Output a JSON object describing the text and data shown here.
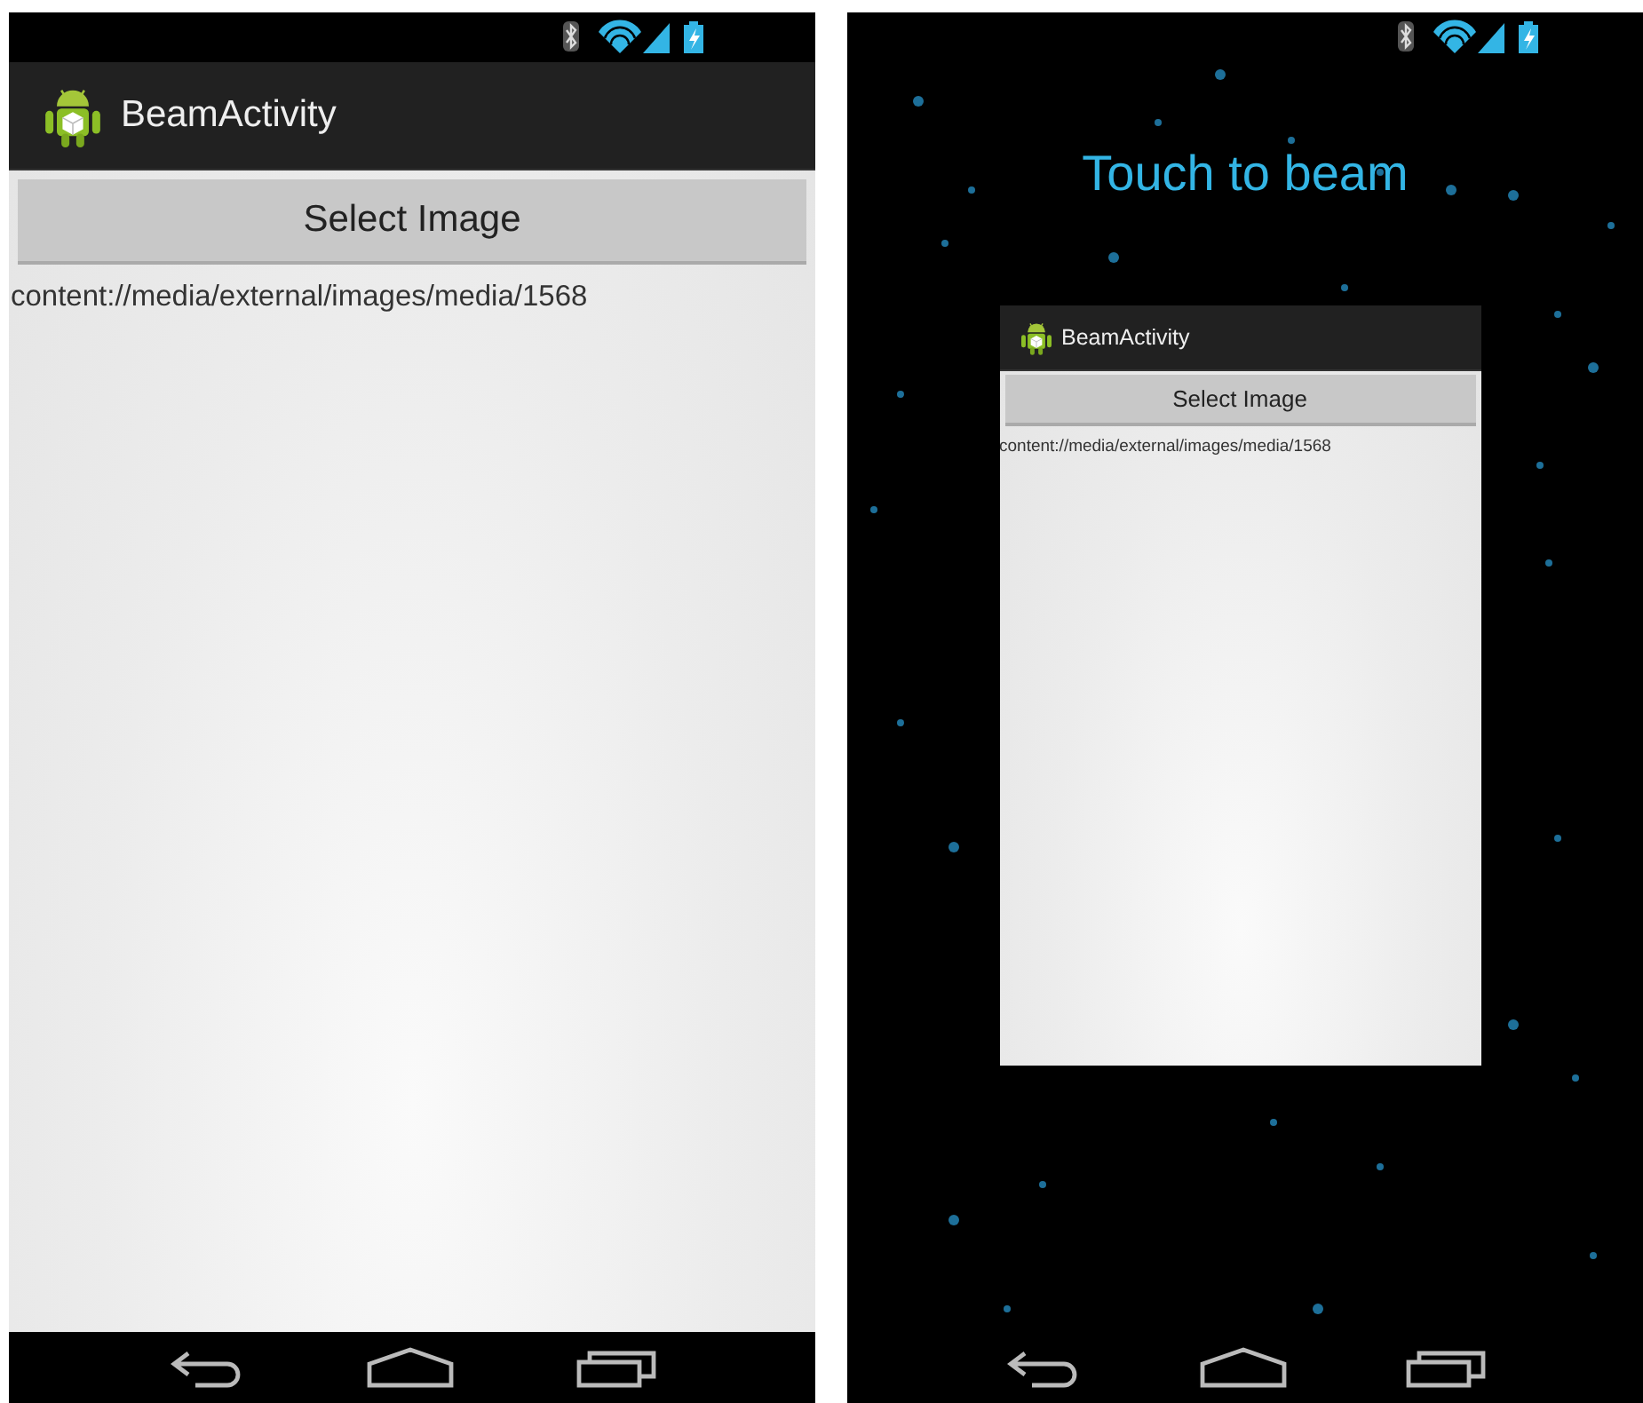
{
  "screens": [
    {
      "kind": "app",
      "action_bar": {
        "title": "BeamActivity"
      },
      "button": "Select Image",
      "uri": "content://media/external/images/media/1568"
    },
    {
      "kind": "beam",
      "prompt": "Touch to beam",
      "preview": {
        "action_bar": {
          "title": "BeamActivity"
        },
        "button": "Select Image",
        "uri": "content://media/external/images/media/1568"
      }
    }
  ]
}
